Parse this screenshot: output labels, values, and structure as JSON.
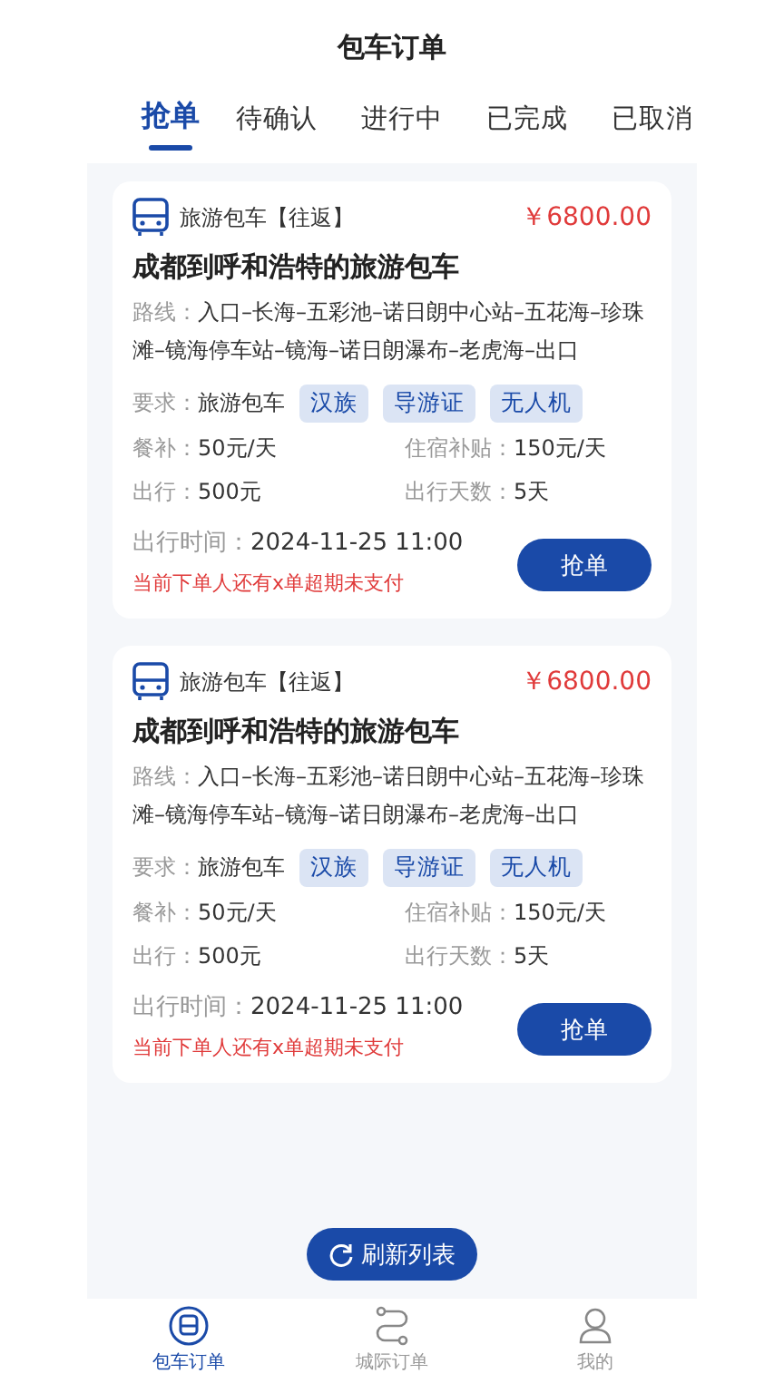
{
  "header": {
    "title": "包车订单"
  },
  "tabs": [
    {
      "label": "抢单",
      "selected": true
    },
    {
      "label": "待确认",
      "selected": false
    },
    {
      "label": "进行中",
      "selected": false
    },
    {
      "label": "已完成",
      "selected": false
    },
    {
      "label": "已取消",
      "selected": false
    }
  ],
  "orders": [
    {
      "type": "旅游包车【往返】",
      "price": "￥6800.00",
      "title": "成都到呼和浩特的旅游包车",
      "route_label": "路线：",
      "route": "入口–长海–五彩池–诺日朗中心站–五花海–珍珠滩–镜海停车站–镜海–诺日朗瀑布–老虎海–出口",
      "req_label": "要求：",
      "req_value": "旅游包车",
      "tags": [
        "汉族",
        "导游证",
        "无人机"
      ],
      "fields": [
        {
          "label": "餐补：",
          "value": "50元/天"
        },
        {
          "label": "住宿补贴：",
          "value": "150元/天"
        },
        {
          "label": "出行：",
          "value": "500元"
        },
        {
          "label": "出行天数：",
          "value": "5天"
        }
      ],
      "time_label": "出行时间：",
      "time": "2024-11-25 11:00",
      "warning": "当前下单人还有x单超期未支付",
      "button": "抢单"
    },
    {
      "type": "旅游包车【往返】",
      "price": "￥6800.00",
      "title": "成都到呼和浩特的旅游包车",
      "route_label": "路线：",
      "route": "入口–长海–五彩池–诺日朗中心站–五花海–珍珠滩–镜海停车站–镜海–诺日朗瀑布–老虎海–出口",
      "req_label": "要求：",
      "req_value": "旅游包车",
      "tags": [
        "汉族",
        "导游证",
        "无人机"
      ],
      "fields": [
        {
          "label": "餐补：",
          "value": "50元/天"
        },
        {
          "label": "住宿补贴：",
          "value": "150元/天"
        },
        {
          "label": "出行：",
          "value": "500元"
        },
        {
          "label": "出行天数：",
          "value": "5天"
        }
      ],
      "time_label": "出行时间：",
      "time": "2024-11-25 11:00",
      "warning": "当前下单人还有x单超期未支付",
      "button": "抢单"
    }
  ],
  "refresh_button": "刷新列表",
  "bottom_nav": [
    {
      "label": "包车订单",
      "kind": "bus",
      "selected": true
    },
    {
      "label": "城际订单",
      "kind": "route",
      "selected": false
    },
    {
      "label": "我的",
      "kind": "person",
      "selected": false
    }
  ]
}
